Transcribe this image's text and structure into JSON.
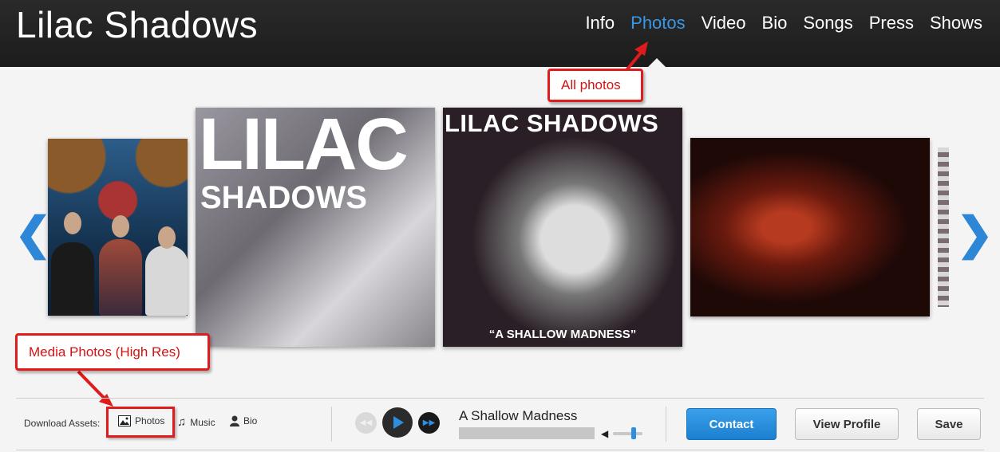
{
  "header": {
    "band_name": "Lilac Shadows",
    "nav": [
      "Info",
      "Photos",
      "Video",
      "Bio",
      "Songs",
      "Press",
      "Shows"
    ],
    "active_nav": "Photos"
  },
  "carousel": {
    "prev_icon": "chevron-left-icon",
    "next_icon": "chevron-right-icon",
    "cover1": {
      "line1": "LILAC",
      "line2": "SHADOWS"
    },
    "cover2": {
      "title": "LILAC SHADOWS",
      "subtitle": "“A SHALLOW MADNESS”"
    }
  },
  "annotations": {
    "all_photos": "All photos",
    "media_photos": "Media Photos (High Res)"
  },
  "assets": {
    "label": "Download Assets:",
    "photos": "Photos",
    "music": "Music",
    "bio": "Bio"
  },
  "player": {
    "track_title": "A Shallow Madness",
    "progress": 0,
    "volume": 0.65
  },
  "actions": {
    "contact": "Contact",
    "view_profile": "View Profile",
    "save": "Save"
  },
  "colors": {
    "accent": "#2e8fe0",
    "annotation": "#e01b1b"
  }
}
